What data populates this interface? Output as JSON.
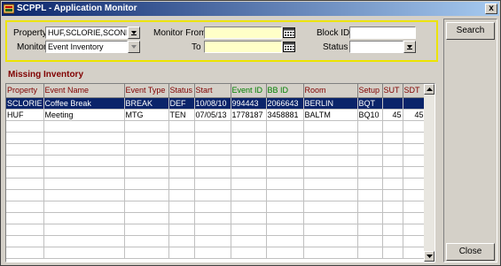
{
  "window": {
    "title": "SCPPL - Application Monitor",
    "close_glyph": "x"
  },
  "filters": {
    "property_label": "Property",
    "property_value": "HUF,SCLORIE,SCONF",
    "monitor_label": "Monitor",
    "monitor_value": "Event Inventory",
    "monitor_from_label": "Monitor From",
    "to_label": "To",
    "block_id_label": "Block ID",
    "status_label": "Status",
    "monitor_from_value": "",
    "to_value": "",
    "block_id_value": "",
    "status_value": ""
  },
  "buttons": {
    "search": "Search",
    "close": "Close"
  },
  "section_title": "Missing Inventory",
  "table": {
    "columns": [
      {
        "label": "Property",
        "color": "#800000"
      },
      {
        "label": "Event Name",
        "color": "#800000"
      },
      {
        "label": "Event Type",
        "color": "#800000"
      },
      {
        "label": "Status",
        "color": "#800000"
      },
      {
        "label": "Start",
        "color": "#800000"
      },
      {
        "label": "Event ID",
        "color": "#008000"
      },
      {
        "label": "BB ID",
        "color": "#008000"
      },
      {
        "label": "Room",
        "color": "#800000"
      },
      {
        "label": "Setup",
        "color": "#800000"
      },
      {
        "label": "SUT",
        "color": "#800000"
      },
      {
        "label": "SDT",
        "color": "#800000"
      }
    ],
    "rows": [
      {
        "selected": true,
        "cells": [
          "SCLORIE",
          "Coffee Break",
          "BREAK",
          "DEF",
          "10/08/10",
          "994443",
          "2066643",
          "BERLIN",
          "BQT",
          "",
          ""
        ]
      },
      {
        "selected": false,
        "cells": [
          "HUF",
          "Meeting",
          "MTG",
          "TEN",
          "07/05/13",
          "1778187",
          "3458881",
          "BALTM",
          "BQ10",
          "45",
          "45"
        ]
      }
    ],
    "empty_rows": 12
  },
  "colors": {
    "selection": "#0a246a",
    "filter_border": "#ece400",
    "header_text": "#800000",
    "id_header_text": "#008000"
  },
  "icons": {
    "app": "app-icon",
    "dropdown": "dropdown-arrow-icon",
    "calendar": "calendar-icon"
  }
}
